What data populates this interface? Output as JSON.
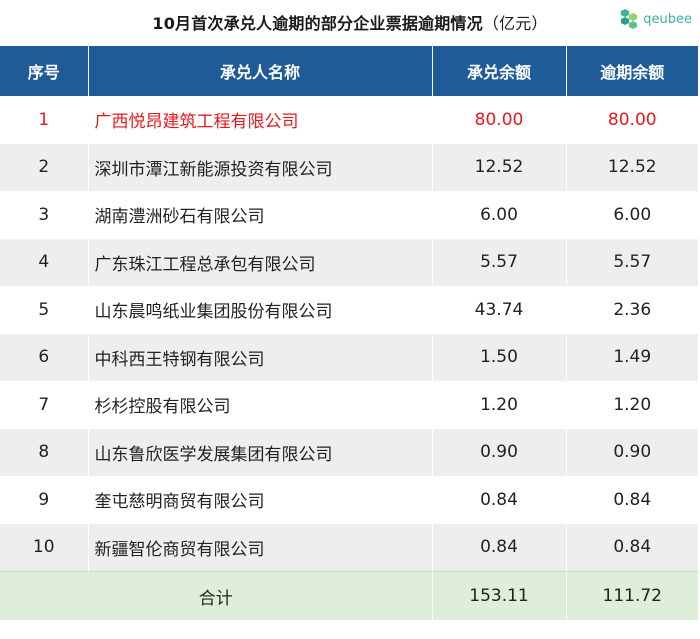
{
  "title": "10月首次承兑人逾期的部分企业票据逾期情况",
  "title_unit": "（亿元）",
  "logo": {
    "text": "qeubee",
    "icon": "hexagon-cluster-icon",
    "color": "#3bb39a"
  },
  "colors": {
    "header_bg": "#1f5b99",
    "highlight": "#e8191e",
    "row_alt": "#eeeeee",
    "total_bg": "#dfeed8"
  },
  "table": {
    "headers": [
      "序号",
      "承兑人名称",
      "承兑余额",
      "逾期余额"
    ],
    "rows": [
      {
        "idx": "1",
        "name": "广西悦昂建筑工程有限公司",
        "accept": "80.00",
        "overdue": "80.00"
      },
      {
        "idx": "2",
        "name": "深圳市潭江新能源投资有限公司",
        "accept": "12.52",
        "overdue": "12.52"
      },
      {
        "idx": "3",
        "name": "湖南澧洲砂石有限公司",
        "accept": "6.00",
        "overdue": "6.00"
      },
      {
        "idx": "4",
        "name": "广东珠江工程总承包有限公司",
        "accept": "5.57",
        "overdue": "5.57"
      },
      {
        "idx": "5",
        "name": "山东晨鸣纸业集团股份有限公司",
        "accept": "43.74",
        "overdue": "2.36"
      },
      {
        "idx": "6",
        "name": "中科西王特钢有限公司",
        "accept": "1.50",
        "overdue": "1.49"
      },
      {
        "idx": "7",
        "name": "杉杉控股有限公司",
        "accept": "1.20",
        "overdue": "1.20"
      },
      {
        "idx": "8",
        "name": "山东鲁欣医学发展集团有限公司",
        "accept": "0.90",
        "overdue": "0.90"
      },
      {
        "idx": "9",
        "name": "奎屯慈明商贸有限公司",
        "accept": "0.84",
        "overdue": "0.84"
      },
      {
        "idx": "10",
        "name": "新疆智伦商贸有限公司",
        "accept": "0.84",
        "overdue": "0.84"
      }
    ],
    "total": {
      "label": "合计",
      "accept": "153.11",
      "overdue": "111.72"
    }
  }
}
